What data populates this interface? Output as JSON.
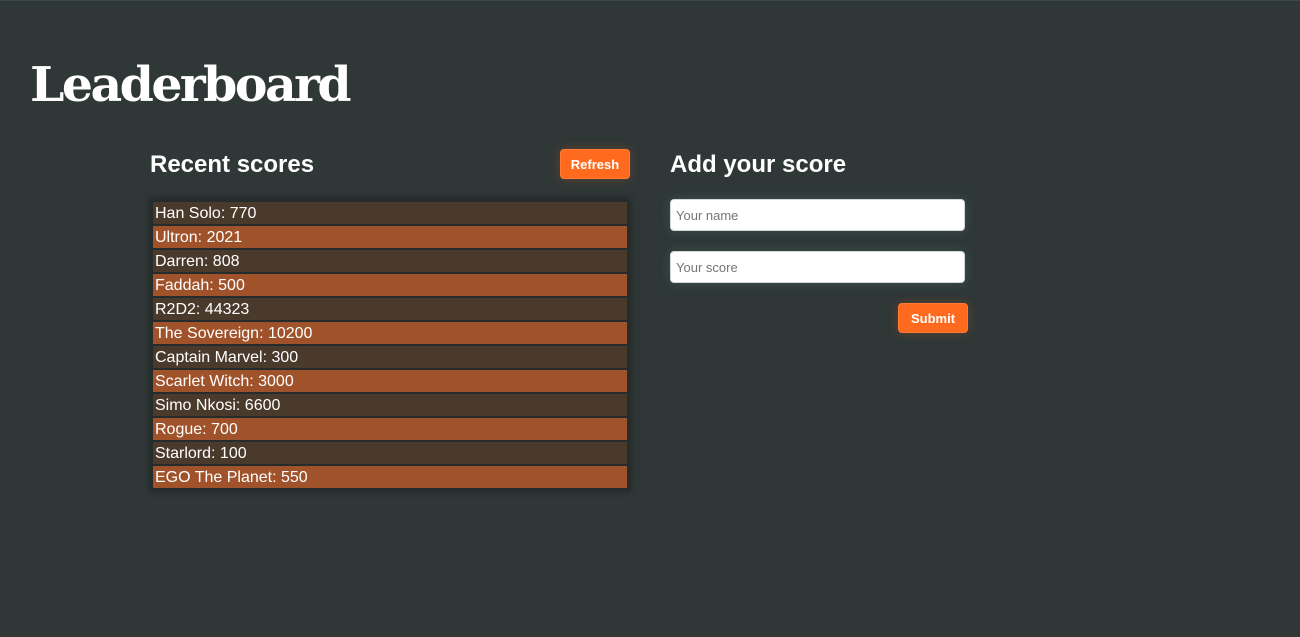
{
  "header": {
    "title": "Leaderboard"
  },
  "recent": {
    "heading": "Recent scores",
    "refresh_label": "Refresh",
    "scores": [
      {
        "text": "Han Solo: 770"
      },
      {
        "text": "Ultron: 2021"
      },
      {
        "text": "Darren: 808"
      },
      {
        "text": "Faddah: 500"
      },
      {
        "text": "R2D2: 44323"
      },
      {
        "text": "The Sovereign: 10200"
      },
      {
        "text": "Captain Marvel: 300"
      },
      {
        "text": "Scarlet Witch: 3000"
      },
      {
        "text": "Simo Nkosi: 6600"
      },
      {
        "text": "Rogue: 700"
      },
      {
        "text": "Starlord: 100"
      },
      {
        "text": "EGO The Planet: 550"
      }
    ]
  },
  "add": {
    "heading": "Add your score",
    "name_placeholder": "Your name",
    "score_placeholder": "Your score",
    "submit_label": "Submit"
  },
  "colors": {
    "background": "#2f3737",
    "accent": "#ff6a1f",
    "row_dark": "#4a3a2c",
    "row_orange": "#a0532a"
  }
}
